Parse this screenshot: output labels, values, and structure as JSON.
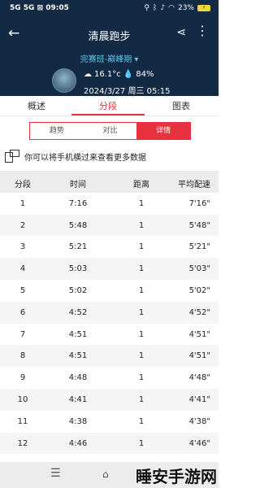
{
  "status": {
    "time": "09:05",
    "left": "5G 5G ⊠ 09:05",
    "right": "23%",
    "icons": [
      "location-icon",
      "bluetooth-icon",
      "silent-icon",
      "wifi-icon"
    ]
  },
  "header": {
    "title": "清晨跑步",
    "crew": "完赛班-巅峰期 ▾",
    "temp": "16.1°c",
    "humidity": "84%",
    "datetime": "2024/3/27 周三 05:15"
  },
  "tabs": [
    "概述",
    "分段",
    "图表"
  ],
  "segment": [
    "趋势",
    "对比",
    "详情"
  ],
  "tip": "你可以将手机横过来查看更多数据",
  "table": {
    "headers": [
      "分段",
      "时间",
      "距离",
      "平均配速"
    ],
    "rows": [
      [
        "1",
        "7:16",
        "1",
        "7'16\""
      ],
      [
        "2",
        "5:48",
        "1",
        "5'48\""
      ],
      [
        "3",
        "5:21",
        "1",
        "5'21\""
      ],
      [
        "4",
        "5:03",
        "1",
        "5'03\""
      ],
      [
        "5",
        "5:02",
        "1",
        "5'02\""
      ],
      [
        "6",
        "4:52",
        "1",
        "4'52\""
      ],
      [
        "7",
        "4:51",
        "1",
        "4'51\""
      ],
      [
        "8",
        "4:51",
        "1",
        "4'51\""
      ],
      [
        "9",
        "4:48",
        "1",
        "4'48\""
      ],
      [
        "10",
        "4:41",
        "1",
        "4'41\""
      ],
      [
        "11",
        "4:38",
        "1",
        "4'38\""
      ],
      [
        "12",
        "4:46",
        "1",
        "4'46\""
      ]
    ]
  },
  "watermark": "睡安手游网",
  "colors": {
    "header_bg": "#132a44",
    "accent": "#e8333f",
    "crew": "#5ec4e8"
  }
}
